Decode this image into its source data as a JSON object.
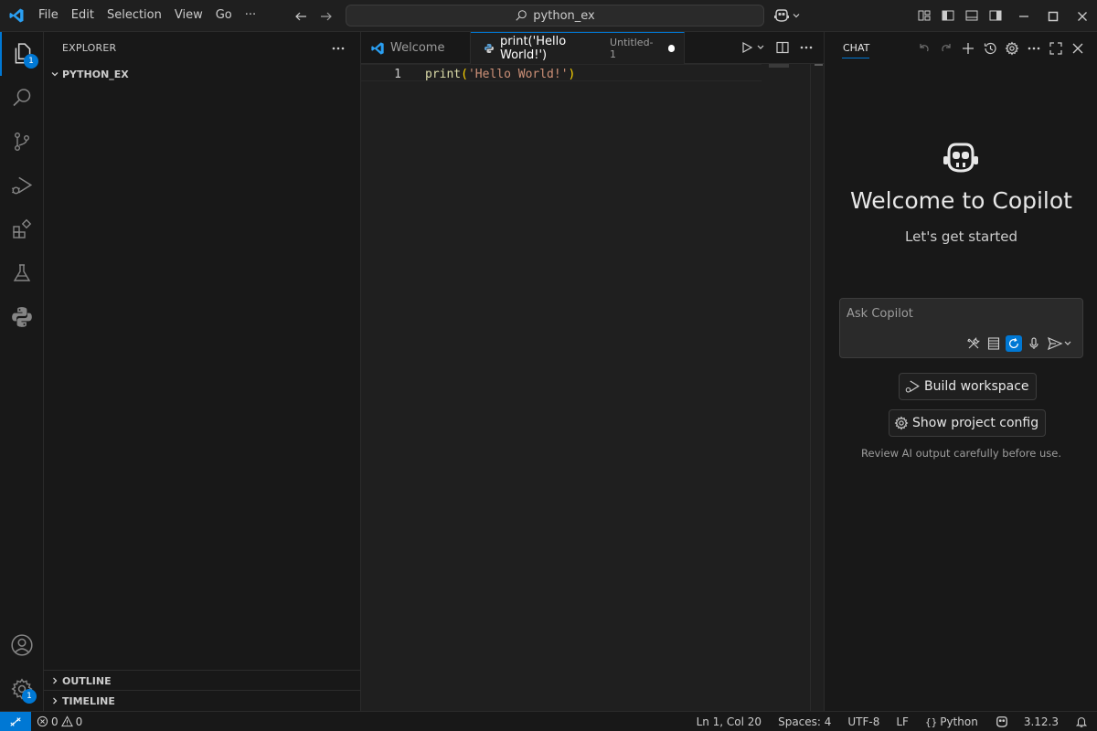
{
  "titlebar": {
    "menu": [
      "File",
      "Edit",
      "Selection",
      "View",
      "Go",
      "···"
    ],
    "search_text": "python_ex"
  },
  "activity": {
    "explorer_badge": "1",
    "settings_badge": "1"
  },
  "sidebar": {
    "title": "EXPLORER",
    "folder": "PYTHON_EX",
    "outline": "OUTLINE",
    "timeline": "TIMELINE"
  },
  "editor": {
    "tabs": [
      {
        "label": "Welcome",
        "icon": "vscode-logo-icon"
      },
      {
        "label": "print('Hello World!')",
        "description": "Untitled-1",
        "icon": "python-file-icon"
      }
    ],
    "line_number": "1",
    "code": {
      "fn": "print",
      "open": "(",
      "str": "'Hello World!'",
      "close": ")"
    }
  },
  "chat": {
    "tab": "CHAT",
    "title": "Welcome to Copilot",
    "subtitle": "Let's get started",
    "placeholder": "Ask Copilot",
    "build_button": "Build workspace",
    "config_button": "Show project config",
    "note": "Review AI output carefully before use."
  },
  "status": {
    "errors": "0",
    "warnings": "0",
    "position": "Ln 1, Col 20",
    "spaces": "Spaces: 4",
    "encoding": "UTF-8",
    "eol": "LF",
    "language": "Python",
    "version": "3.12.3"
  },
  "colors": {
    "accent": "#0078d4",
    "background": "#1f1f1f",
    "sidebar": "#181818"
  }
}
